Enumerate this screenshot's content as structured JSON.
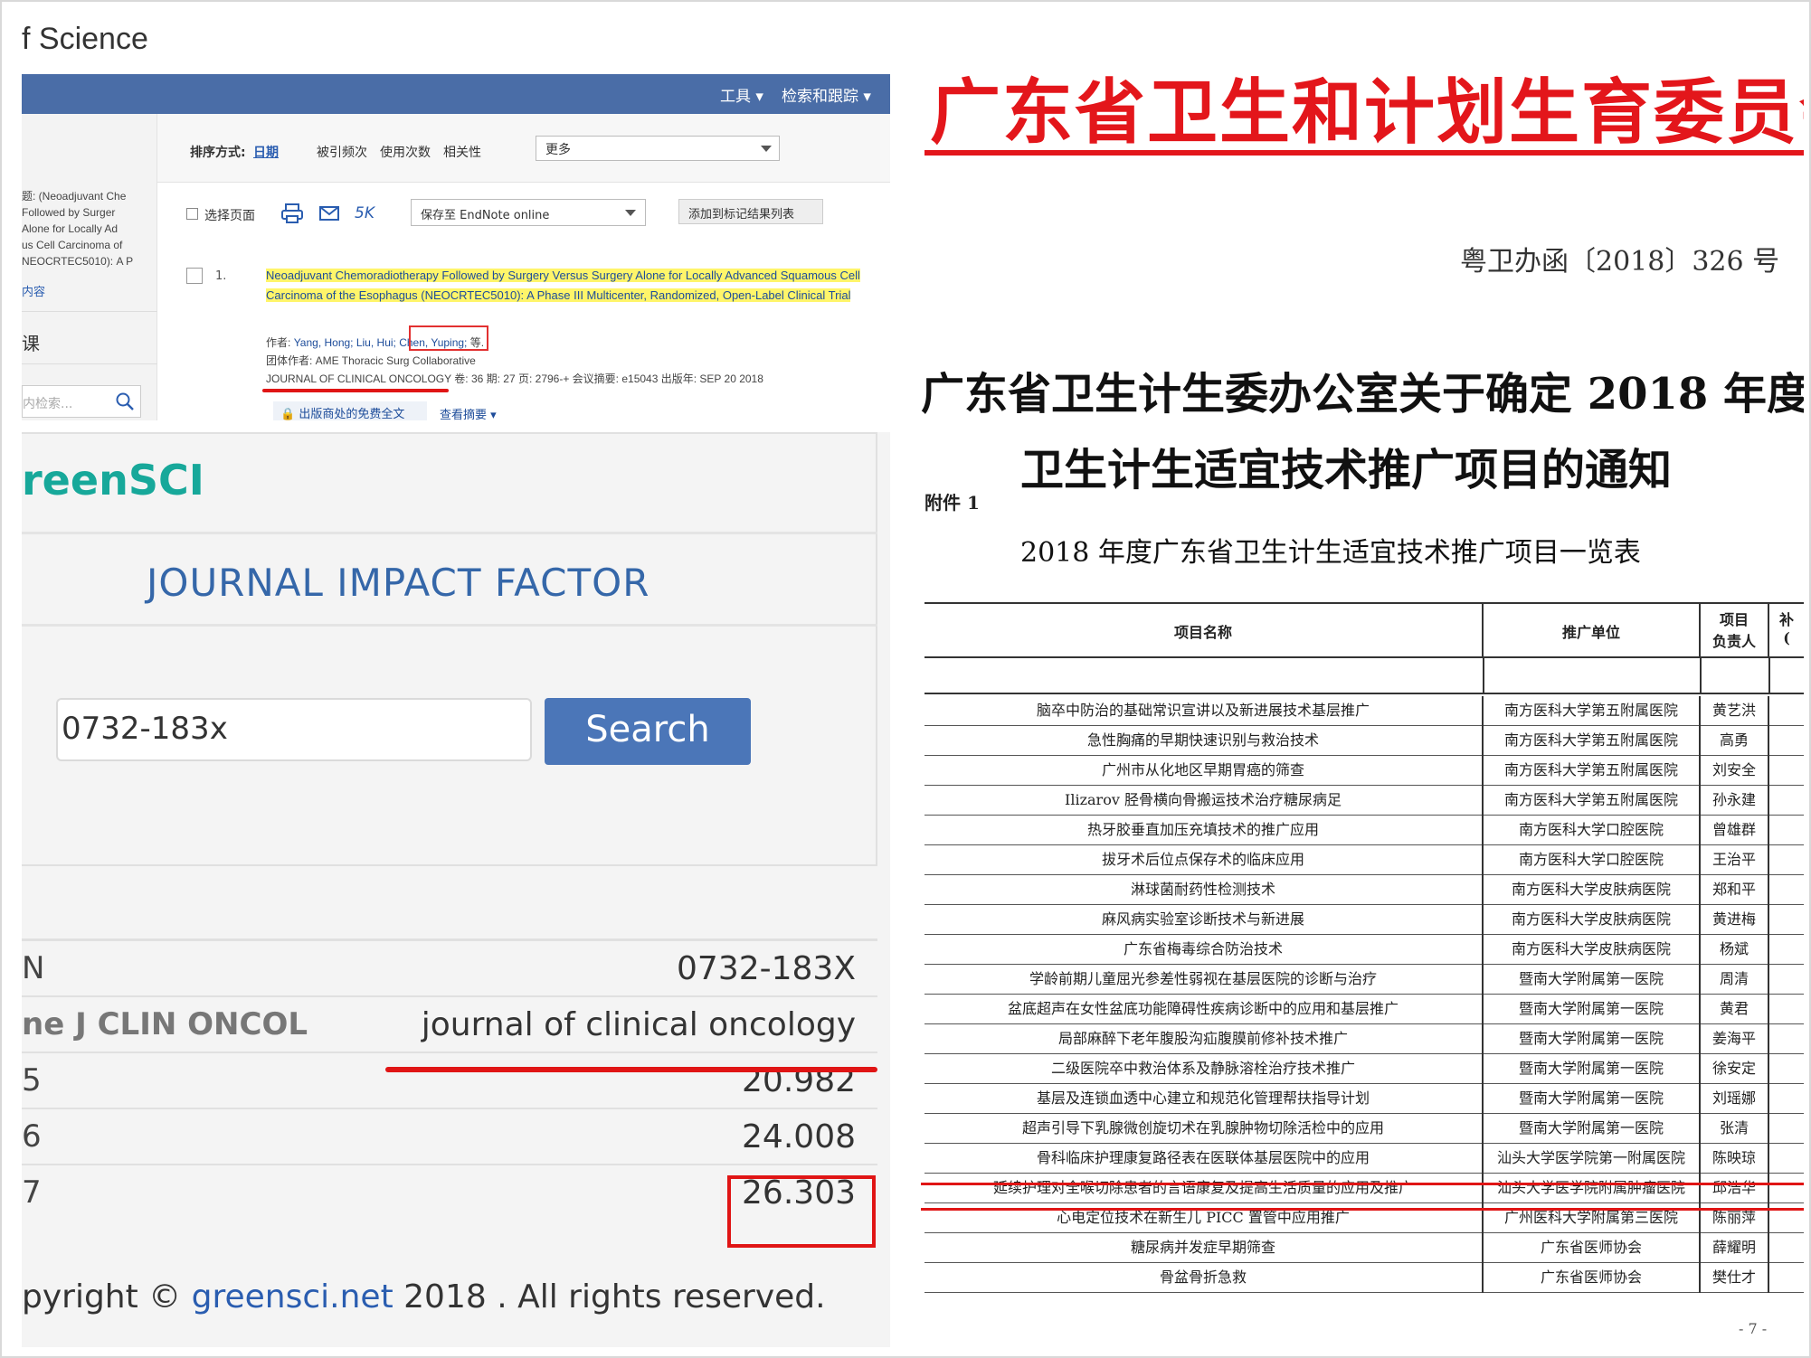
{
  "wos": {
    "brand": "f Science",
    "topnav": [
      "工具 ▾",
      "检索和跟踪 ▾"
    ],
    "side": {
      "text": "题: (Neoadjuvant Che\nFollowed by Surger\nAlone for Locally Ad\nus Cell Carcinoma of\nNEOCRTEC5010): A P",
      "link": "内容",
      "heading": "课",
      "search_placeholder": "内检索..."
    },
    "sort": {
      "prefix": "排序方式:",
      "date": "日期",
      "options": [
        "被引频次",
        "使用次数",
        "相关性"
      ],
      "more": "更多"
    },
    "tools": {
      "select_page": "选择页面",
      "five_k": "5K",
      "save_to": "保存至 EndNote online",
      "add_to_list": "添加到标记结果列表"
    },
    "record": {
      "number": "1.",
      "title": "Neoadjuvant Chemoradiotherapy Followed by Surgery Versus Surgery Alone for Locally Advanced Squamous Cell Carcinoma of the Esophagus (NEOCRTEC5010): A Phase III Multicenter, Randomized, Open-Label Clinical Trial",
      "authors_prefix": "作者:",
      "authors_a": "Yang, Hong; Liu, Hui;",
      "authors_b": "Chen, Yuping;",
      "authors_suffix": "等.",
      "group": "团体作者: AME Thoracic Surg Collaborative",
      "journal": "JOURNAL OF CLINICAL ONCOLOGY",
      "meta": "卷: 36   期: 27   页: 2796-+   会议摘要: e15043   出版年: SEP 20 2018",
      "fulltext": "出版商处的免费全文",
      "abstract": "查看摘要 ▾"
    }
  },
  "greensci": {
    "logo": "reenSCI",
    "heading": "JOURNAL IMPACT FACTOR",
    "search_value": "0732-183x",
    "search_button": "Search",
    "rows": [
      {
        "key": "N",
        "value": "0732-183X"
      },
      {
        "key": "ne J CLIN ONCOL",
        "value": "journal of clinical oncology"
      },
      {
        "key": "5",
        "value": "20.982"
      },
      {
        "key": "6",
        "value": "24.008"
      },
      {
        "key": "7",
        "value": "26.303"
      }
    ],
    "copyright_a": "pyright ©",
    "copyright_link": "greensci.net",
    "copyright_b": "2018 . All rights reserved."
  },
  "doc": {
    "title": "广东省卫生和计划生育委员会",
    "ref": "粤卫办函〔2018〕326 号",
    "heading_line1": "广东省卫生计生委办公室关于确定 2018 年度",
    "heading_line2": "卫生计生适宜技术推广项目的通知",
    "attachment": "附件 1",
    "list_title": "2018 年度广东省卫生计生适宜技术推广项目一览表",
    "columns": [
      "项目名称",
      "推广单位",
      "项目",
      "负责人",
      "补",
      "("
    ],
    "rows": [
      [
        "脑卒中防治的基础常识宣讲以及新进展技术基层推广",
        "南方医科大学第五附属医院",
        "黄艺洪"
      ],
      [
        "急性胸痛的早期快速识别与救治技术",
        "南方医科大学第五附属医院",
        "高勇"
      ],
      [
        "广州市从化地区早期胃癌的筛查",
        "南方医科大学第五附属医院",
        "刘安全"
      ],
      [
        "Ilizarov 胫骨横向骨搬运技术治疗糖尿病足",
        "南方医科大学第五附属医院",
        "孙永建"
      ],
      [
        "热牙胶垂直加压充填技术的推广应用",
        "南方医科大学口腔医院",
        "曾雄群"
      ],
      [
        "拔牙术后位点保存术的临床应用",
        "南方医科大学口腔医院",
        "王治平"
      ],
      [
        "淋球菌耐药性检测技术",
        "南方医科大学皮肤病医院",
        "郑和平"
      ],
      [
        "麻风病实验室诊断技术与新进展",
        "南方医科大学皮肤病医院",
        "黄进梅"
      ],
      [
        "广东省梅毒综合防治技术",
        "南方医科大学皮肤病医院",
        "杨斌"
      ],
      [
        "学龄前期儿童屈光参差性弱视在基层医院的诊断与治疗",
        "暨南大学附属第一医院",
        "周清"
      ],
      [
        "盆底超声在女性盆底功能障碍性疾病诊断中的应用和基层推广",
        "暨南大学附属第一医院",
        "黄君"
      ],
      [
        "局部麻醉下老年腹股沟疝腹膜前修补技术推广",
        "暨南大学附属第一医院",
        "姜海平"
      ],
      [
        "二级医院卒中救治体系及静脉溶栓治疗技术推广",
        "暨南大学附属第一医院",
        "徐安定"
      ],
      [
        "基层及连锁血透中心建立和规范化管理帮扶指导计划",
        "暨南大学附属第一医院",
        "刘瑶娜"
      ],
      [
        "超声引导下乳腺微创旋切术在乳腺肿物切除活检中的应用",
        "暨南大学附属第一医院",
        "张清"
      ],
      [
        "骨科临床护理康复路径表在医联体基层医院中的应用",
        "汕头大学医学院第一附属医院",
        "陈映琼"
      ],
      [
        "延续护理对全喉切除患者的言语康复及提高生活质量的应用及推广",
        "汕头大学医学院附属肿瘤医院",
        "邱浩华"
      ],
      [
        "心电定位技术在新生儿 PICC 置管中应用推广",
        "广州医科大学附属第三医院",
        "陈丽萍"
      ],
      [
        "糖尿病并发症早期筛查",
        "广东省医师协会",
        "薛耀明"
      ],
      [
        "骨盆骨折急救",
        "广东省医师协会",
        "樊仕才"
      ]
    ],
    "page": "- 7 -"
  }
}
